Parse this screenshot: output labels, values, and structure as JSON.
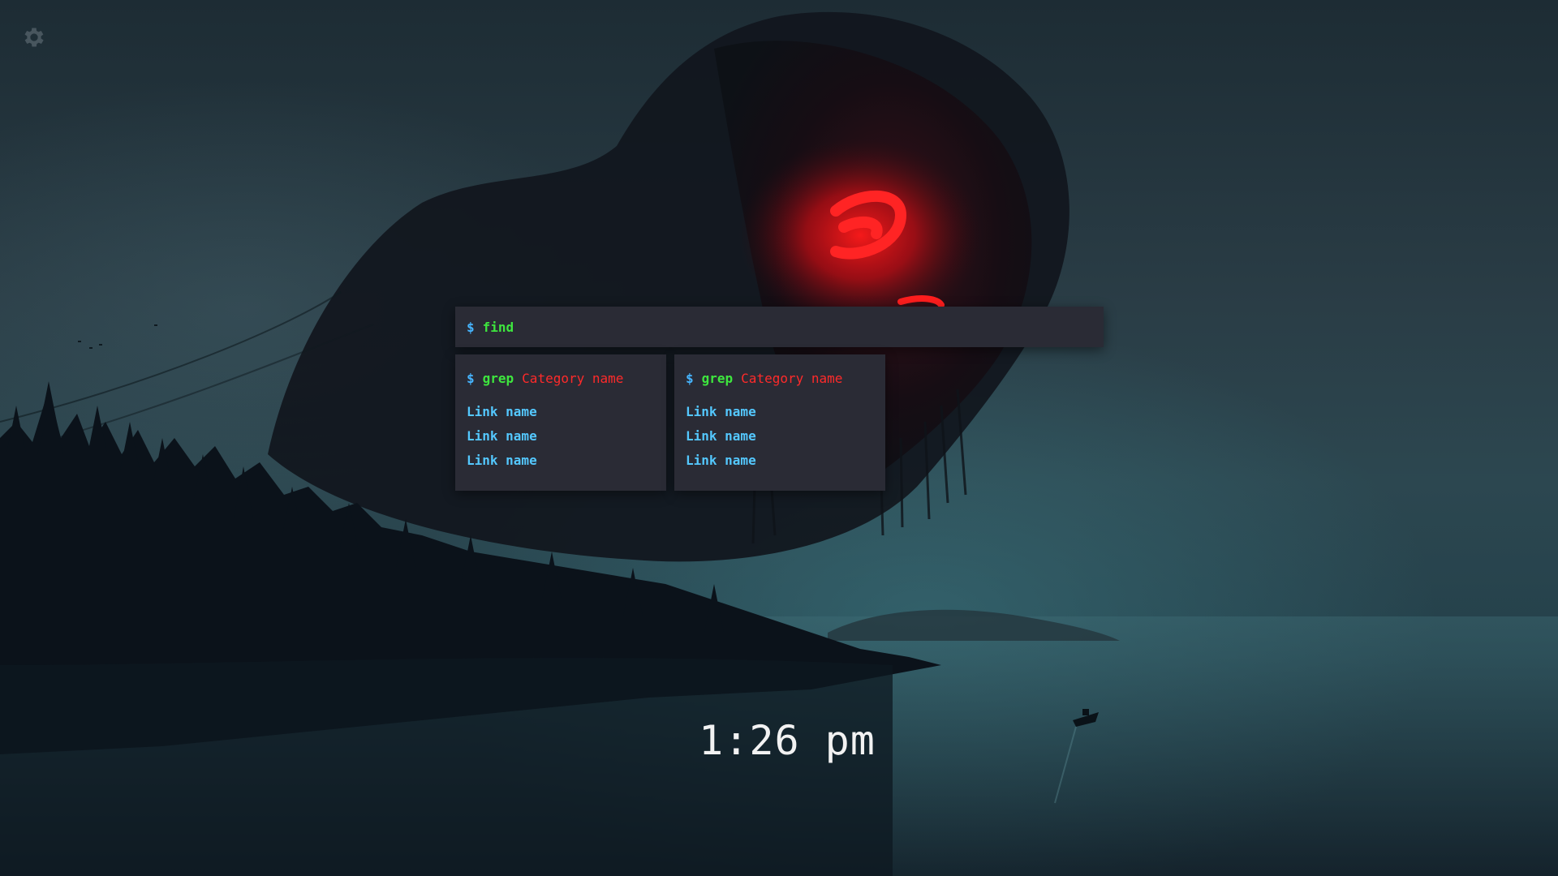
{
  "settings": {
    "icon": "gear-icon"
  },
  "search": {
    "prompt": "$",
    "command": "find",
    "value": "",
    "placeholder": ""
  },
  "categories": [
    {
      "prompt": "$",
      "command": "grep",
      "name": "Category name",
      "links": [
        "Link name",
        "Link name",
        "Link name"
      ]
    },
    {
      "prompt": "$",
      "command": "grep",
      "name": "Category name",
      "links": [
        "Link name",
        "Link name",
        "Link name"
      ]
    }
  ],
  "clock": {
    "time": "1:26 pm"
  },
  "colors": {
    "panel_bg": "#2a2b35",
    "prompt": "#46b5ff",
    "command": "#3ee63e",
    "category": "#ff2a2a",
    "link": "#54c8ff",
    "clock": "#f2f2f2"
  }
}
